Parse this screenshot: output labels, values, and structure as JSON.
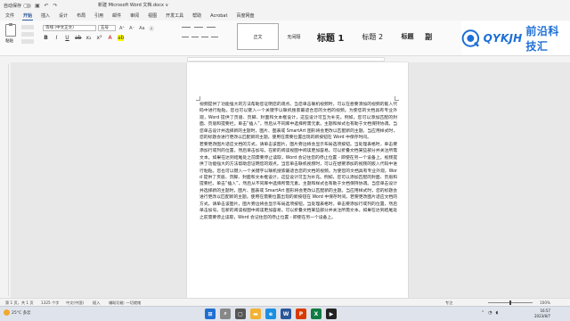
{
  "titlebar": {
    "autosave_label": "自动保存",
    "doc_title": "新建 Microsoft Word 文档.docx ∨"
  },
  "menu": {
    "tabs": [
      "文件",
      "开始",
      "插入",
      "设计",
      "布局",
      "引用",
      "邮件",
      "审阅",
      "视图",
      "开发工具",
      "帮助",
      "Acrobat",
      "百度网盘"
    ],
    "active_index": 1
  },
  "ribbon": {
    "paste_label": "粘贴",
    "font_name": "等线 (中文正文)",
    "font_size": "五号",
    "styles": [
      "正文",
      "无间隔",
      "标题 1",
      "标题 2",
      "标题",
      "副"
    ],
    "selected_style_index": 0
  },
  "logo": {
    "latin": "QYKJH",
    "chinese": "前沿科技汇",
    "color": "#1d6fd6"
  },
  "document": {
    "paragraphs": [
      "视频提供了功能强大的方法帮助您证明您的观点。当您单击联机视频时，可以在想要添加的视频的嵌入代码中进行粘贴。您也可以键入一个关键字以联机搜索最适合您的文档的视频。为使您的文档具有专业外观，Word 提供了页眉、页脚、封面和文本框设计，这些设计可互为补充。例如，您可以添加匹配的封面、页眉和提要栏。单击“插入”，然后从不同库中选择所需元素。主题和样式也有助于文档保持协调。当您单击设计并选择新的主题时，图片、图表或 SmartArt 图形将会更改以匹配新的主题。当应用样式时，您的标题会进行更改以匹配新的主题。使用在需要位置出现的新按钮在 Word 中保存时间。",
      "若要更改图片适应文档的方式，请单击该图片，图片旁边将会显示布局选项按钮。当处理表格时，单击要添加行或列的位置，然后单击加号。在新的阅读视图中阅读更加容易。可以折叠文档某些部分并关注所需文本。如果在达到结尾处之前需要停止读取，Word 会记住您的停止位置 - 即使在另一个设备上。视频提供了功能强大的方法帮助您证明您的观点。当您单击联机视频时，可以在想要添加的视频的嵌入代码中进行粘贴。您也可以键入一个关键字以联机搜索最适合您的文档的视频。为使您的文档具有专业外观，Word 提供了页眉、页脚、封面和文本框设计，这些设计可互为补充。例如，您可以添加匹配的封面、页眉和提要栏。单击“插入”，然后从不同库中选择所需元素。主题和样式也有助于文档保持协调。当您单击设计并选择新的主题时，图片、图表或 SmartArt 图形将会更改以匹配新的主题。当应用样式时，您的标题会进行更改以匹配新的主题。使用在需要位置出现的新按钮在 Word 中保存时间。若要更改图片适应文档的方式，请单击该图片，图片旁边将会显示布局选项按钮。当处理表格时，单击要添加行或列的位置，然后单击加号。在新的阅读视图中阅读更加容易。可以折叠文档某些部分并关注所需文本。如果在达到结尾处之前需要停止读取，Word 会记住您的停止位置 - 即使在另一个设备上。"
    ]
  },
  "statusbar": {
    "page": "第 1 页，共 1 页",
    "words": "1325 个字",
    "language": "中文(中国)",
    "input_mode": "插入",
    "accessibility": "辅助功能: 一切就绪",
    "focus": "专注",
    "zoom": "100%"
  },
  "taskbar": {
    "temperature": "25°C",
    "weather": "多云",
    "time": "16:57",
    "date": "2023/8/7"
  }
}
